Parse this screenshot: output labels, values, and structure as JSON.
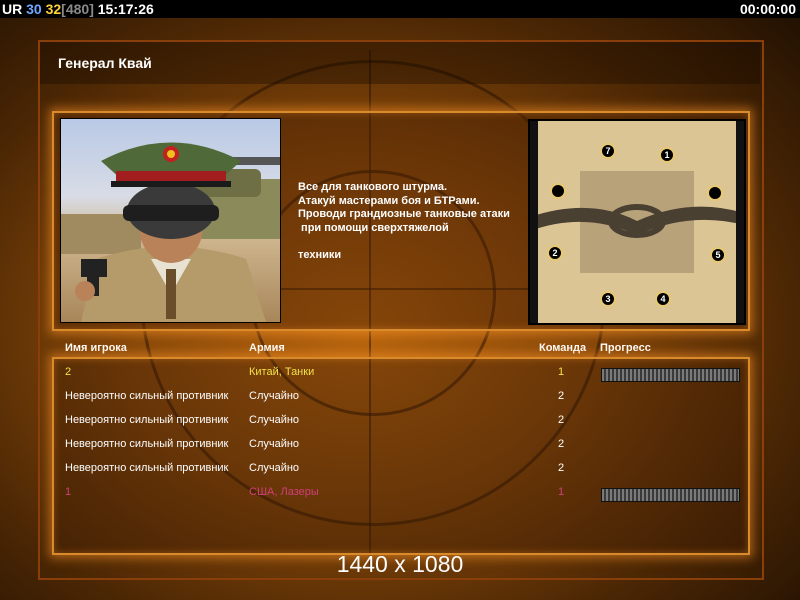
{
  "hud": {
    "prefix": "UR",
    "level": "30",
    "count": "32",
    "bracket": "[480]",
    "clock": "15:17:26",
    "timer": "00:00:00"
  },
  "briefing": {
    "title": "Генерал Квай",
    "lines": [
      "Все для танкового штурма.",
      "Атакуй мастерами боя и БТРами.",
      "Проводи грандиозные танковые атаки",
      " при помощи сверхтяжелой",
      "",
      "техники"
    ]
  },
  "map": {
    "start_positions": [
      "1",
      "2",
      "3",
      "4",
      "5",
      "7"
    ]
  },
  "table": {
    "headers": {
      "name": "Имя игрока",
      "army": "Армия",
      "team": "Команда",
      "progress": "Прогресс"
    },
    "rows": [
      {
        "name": "2",
        "army": "Китай, Танки",
        "team": "1",
        "color": "#f2e24a",
        "progress": 1.0
      },
      {
        "name": "Невероятно сильный противник",
        "army": "Случайно",
        "team": "2",
        "color": "#ffffff"
      },
      {
        "name": "Невероятно сильный противник",
        "army": "Случайно",
        "team": "2",
        "color": "#ffffff"
      },
      {
        "name": "Невероятно сильный противник",
        "army": "Случайно",
        "team": "2",
        "color": "#ffffff"
      },
      {
        "name": "Невероятно сильный противник",
        "army": "Случайно",
        "team": "2",
        "color": "#ffffff"
      },
      {
        "name": "1",
        "army": "США, Лазеры",
        "team": "1",
        "color": "#d0407a",
        "progress": 1.0
      }
    ]
  },
  "resolution": "1440 x 1080"
}
